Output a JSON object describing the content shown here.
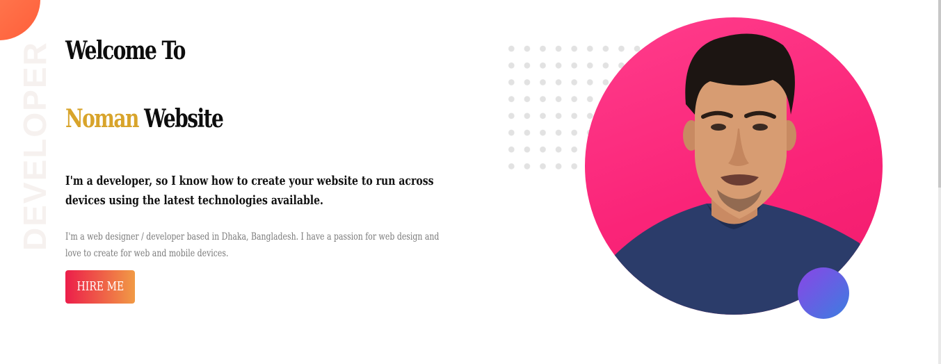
{
  "hero": {
    "side_word": "DEVELOPER",
    "title_line1": "Welcome To",
    "name_highlight": "Noman",
    "name_rest": "Website",
    "tagline": "I'm a developer, so I know how to create your website to run across devices using the latest technologies available.",
    "description": "I'm a web designer / developer based in Dhaka, Bangladesh. I have a passion for web design and love to create for web and mobile devices.",
    "cta_label": "HIRE ME"
  },
  "colors": {
    "accent": "#d8a42b",
    "photo_bg": "#fa2478",
    "cta_gradient_start": "#ec1e4a",
    "cta_gradient_end": "#f19a45",
    "blob_orange": "#ff6b45",
    "small_circle": "#6a5ae6"
  },
  "icons": {
    "portrait": "profile-photo"
  }
}
